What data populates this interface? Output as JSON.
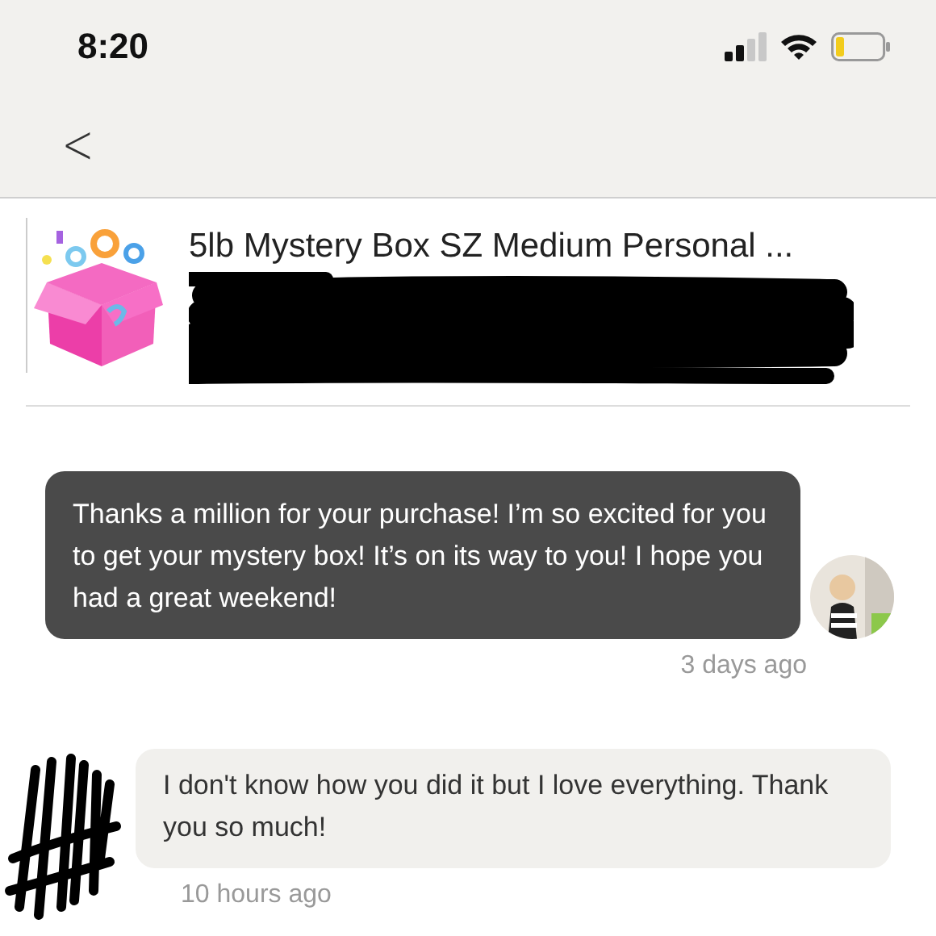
{
  "status_bar": {
    "time": "8:20"
  },
  "nav": {
    "back": "<"
  },
  "product": {
    "title": "5lb Mystery Box SZ Medium Personal ..."
  },
  "messages": [
    {
      "kind": "seller",
      "text": "Thanks a million for your purchase! I’m so excited for you to get your mystery box! It’s on its way to you! I hope you had a great weekend!",
      "time": "3 days ago"
    },
    {
      "kind": "buyer",
      "text": "I don't know how you did it but I love everything. Thank you so much!",
      "time": "10 hours ago"
    }
  ]
}
